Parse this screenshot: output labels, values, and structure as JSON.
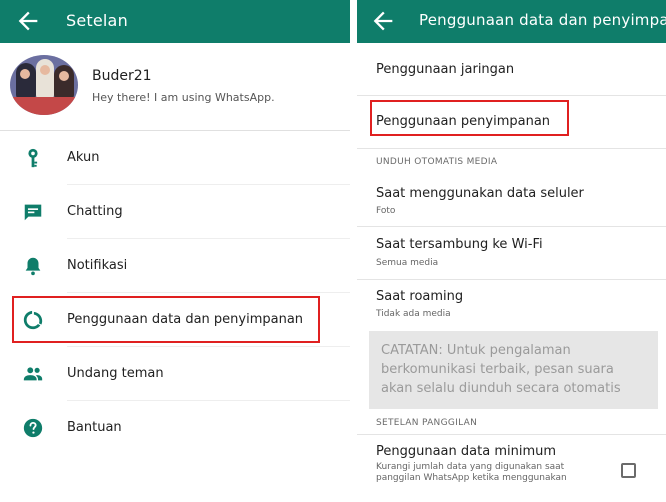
{
  "left": {
    "appbar": {
      "title": "Setelan"
    },
    "profile": {
      "name": "Buder21",
      "status": "Hey there! I am using WhatsApp."
    },
    "items": [
      {
        "label": "Akun",
        "icon": "key-icon"
      },
      {
        "label": "Chatting",
        "icon": "chat-icon"
      },
      {
        "label": "Notifikasi",
        "icon": "bell-icon"
      },
      {
        "label": "Penggunaan data dan penyimpanan",
        "icon": "data-usage-icon"
      },
      {
        "label": "Undang teman",
        "icon": "people-icon"
      },
      {
        "label": "Bantuan",
        "icon": "help-icon"
      }
    ]
  },
  "right": {
    "appbar": {
      "title": "Penggunaan data dan penyimpan"
    },
    "network_usage": "Penggunaan jaringan",
    "storage_usage": "Penggunaan penyimpanan",
    "auto_download_header": "UNDUH OTOMATIS MEDIA",
    "auto_download": [
      {
        "title": "Saat menggunakan data seluler",
        "value": "Foto"
      },
      {
        "title": "Saat tersambung ke Wi-Fi",
        "value": "Semua media"
      },
      {
        "title": "Saat roaming",
        "value": "Tidak ada media"
      }
    ],
    "note": "CATATAN: Untuk pengalaman berkomunikasi terbaik, pesan suara akan selalu diunduh secara otomatis",
    "call_settings_header": "SETELAN PANGGILAN",
    "low_data": {
      "title": "Penggunaan data minimum",
      "description": "Kurangi jumlah data yang digunakan saat panggilan WhatsApp ketika menggunakan",
      "checked": false
    }
  },
  "colors": {
    "appbar": "#0f7d6a",
    "accent": "#0f7d6a",
    "highlight": "#e02020"
  }
}
